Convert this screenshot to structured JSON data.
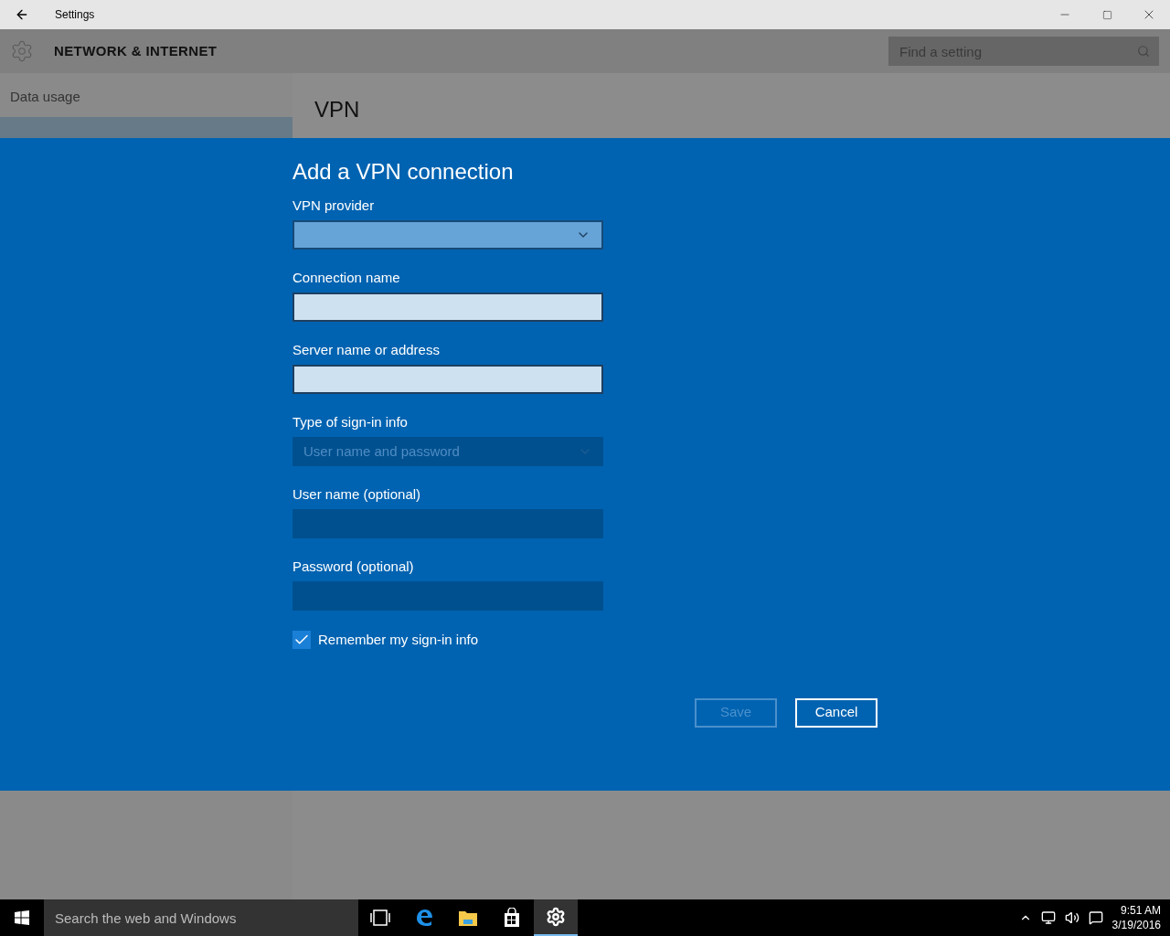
{
  "window": {
    "title": "Settings"
  },
  "header": {
    "title": "NETWORK & INTERNET",
    "search": {
      "placeholder": "Find a setting"
    }
  },
  "sidebar": {
    "items": [
      {
        "label": "Data usage",
        "selected": false
      }
    ]
  },
  "page": {
    "title": "VPN"
  },
  "dialog": {
    "title": "Add a VPN connection",
    "fields": [
      {
        "label": "VPN provider",
        "kind": "dropdown",
        "disabled": false
      },
      {
        "label": "Connection name",
        "kind": "text",
        "disabled": false
      },
      {
        "label": "Server name or address",
        "kind": "text",
        "disabled": false
      },
      {
        "label": "Type of sign-in info",
        "kind": "dropdown",
        "disabled": true,
        "value": "User name and password"
      },
      {
        "label": "User name (optional)",
        "kind": "text",
        "disabled": true
      },
      {
        "label": "Password (optional)",
        "kind": "text",
        "disabled": true
      }
    ],
    "remember": {
      "label": "Remember my sign-in info",
      "checked": true
    },
    "buttons": [
      {
        "label": "Save",
        "disabled": true
      },
      {
        "label": "Cancel",
        "disabled": false
      }
    ]
  },
  "taskbar": {
    "search": {
      "placeholder": "Search the web and Windows"
    },
    "apps": [
      {
        "kind": "taskview",
        "selected": false
      },
      {
        "kind": "edge",
        "selected": false
      },
      {
        "kind": "explorer",
        "selected": false
      },
      {
        "kind": "store",
        "selected": false
      },
      {
        "kind": "settings",
        "selected": true
      }
    ],
    "time": "9:51 AM",
    "date": "3/19/2016"
  }
}
